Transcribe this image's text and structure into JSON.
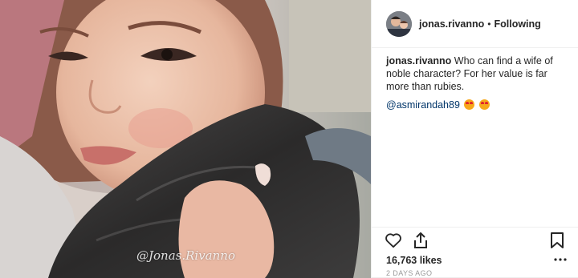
{
  "post": {
    "watermark": "@Jonas.Rivanno"
  },
  "header": {
    "username": "jonas.rivanno",
    "separator": "•",
    "follow_status": "Following",
    "avatar_icon": "user-avatar"
  },
  "caption": {
    "username": "jonas.rivanno",
    "text": "Who can find a wife of noble character? For her value is far more than rubies."
  },
  "comment": {
    "mention": "@asmirandah89",
    "emojis": [
      "star-struck-emoji",
      "star-struck-emoji"
    ]
  },
  "actions": {
    "icons": [
      "heart-icon",
      "share-icon",
      "bookmark-icon",
      "more-options-icon"
    ]
  },
  "likes": "16,763 likes",
  "timestamp": "2 DAYS AGO",
  "colors": {
    "text": "#262626",
    "mention": "#003569",
    "muted": "#999999",
    "border": "#efefef"
  }
}
